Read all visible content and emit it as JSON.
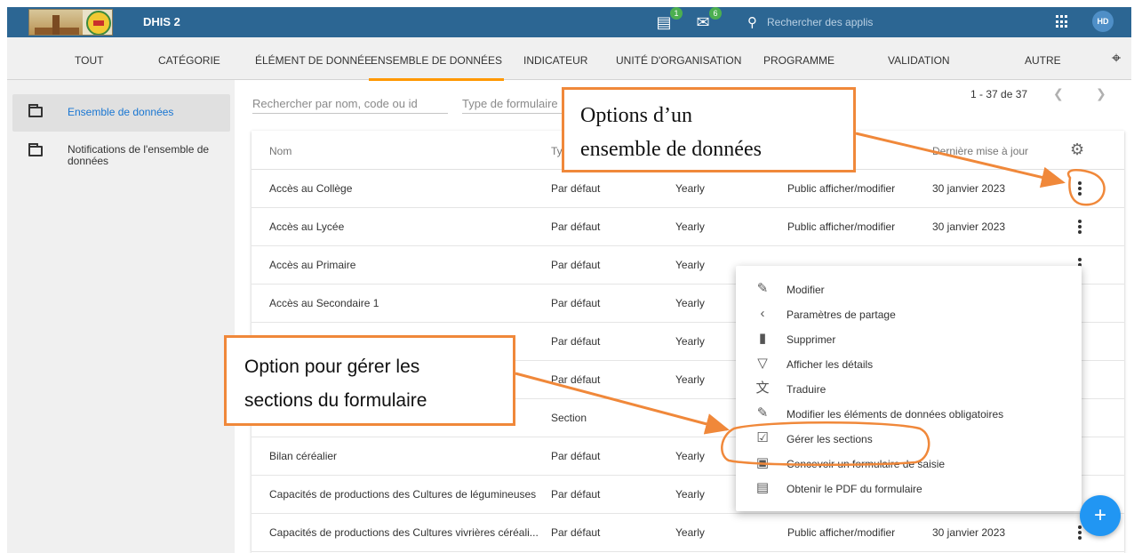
{
  "header": {
    "app_title": "DHIS 2",
    "messages_badge": "1",
    "interpretations_badge": "6",
    "search_placeholder": "Rechercher des applis",
    "avatar_initials": "HD"
  },
  "tabs": [
    {
      "label": "TOUT"
    },
    {
      "label": "CATÉGORIE"
    },
    {
      "label": "ÉLÉMENT DE DONNÉE"
    },
    {
      "label": "ENSEMBLE DE DONNÉES"
    },
    {
      "label": "INDICATEUR"
    },
    {
      "label": "UNITÉ D'ORGANISATION"
    },
    {
      "label": "PROGRAMME"
    },
    {
      "label": "VALIDATION"
    },
    {
      "label": "AUTRE"
    }
  ],
  "sidebar": {
    "items": [
      {
        "label": "Ensemble de données"
      },
      {
        "label": "Notifications de l'ensemble de données"
      }
    ]
  },
  "filters": {
    "search_placeholder": "Rechercher par nom, code ou id",
    "form_type_placeholder": "Type de formulaire"
  },
  "pager": {
    "range": "1 - 37 de 37"
  },
  "table": {
    "headers": {
      "name": "Nom",
      "type": "Ty",
      "last_updated": "Dernière mise à jour"
    },
    "rows": [
      {
        "name": "Accès au Collège",
        "type": "Par défaut",
        "period": "Yearly",
        "sharing": "Public afficher/modifier",
        "updated": "30 janvier 2023"
      },
      {
        "name": "Accès au Lycée",
        "type": "Par défaut",
        "period": "Yearly",
        "sharing": "Public afficher/modifier",
        "updated": "30 janvier 2023"
      },
      {
        "name": "Accès au Primaire",
        "type": "Par défaut",
        "period": "Yearly",
        "sharing": "",
        "updated": ""
      },
      {
        "name": "Accès au Secondaire 1",
        "type": "Par défaut",
        "period": "Yearly",
        "sharing": "",
        "updated": ""
      },
      {
        "name": "",
        "type": "Par défaut",
        "period": "Yearly",
        "sharing": "",
        "updated": ""
      },
      {
        "name": "",
        "type": "Par défaut",
        "period": "Yearly",
        "sharing": "",
        "updated": ""
      },
      {
        "name": "",
        "type": "Section",
        "period": "",
        "sharing": "",
        "updated": ""
      },
      {
        "name": "Bilan céréalier",
        "type": "Par défaut",
        "period": "Yearly",
        "sharing": "",
        "updated": ""
      },
      {
        "name": "Capacités de productions des Cultures de légumineuses",
        "type": "Par défaut",
        "period": "Yearly",
        "sharing": "",
        "updated": ""
      },
      {
        "name": "Capacités de productions des Cultures vivrières céréali...",
        "type": "Par défaut",
        "period": "Yearly",
        "sharing": "Public afficher/modifier",
        "updated": "30 janvier 2023"
      }
    ]
  },
  "context_menu": {
    "items": [
      {
        "label": "Modifier",
        "icon": "pencil-icon"
      },
      {
        "label": "Paramètres de partage",
        "icon": "share-icon"
      },
      {
        "label": "Supprimer",
        "icon": "trash-icon"
      },
      {
        "label": "Afficher les détails",
        "icon": "details-icon"
      },
      {
        "label": "Traduire",
        "icon": "translate-icon"
      },
      {
        "label": "Modifier les éléments de données obligatoires",
        "icon": "pencil-icon"
      },
      {
        "label": "Gérer les sections",
        "icon": "clipboard-check-icon"
      },
      {
        "label": "Concevoir un formulaire de saisie",
        "icon": "clipboard-account-icon"
      },
      {
        "label": "Obtenir le PDF du formulaire",
        "icon": "pdf-icon"
      }
    ]
  },
  "annotations": {
    "callout_options_line1": "Options d’un",
    "callout_options_line2": "ensemble de données",
    "callout_sections_line1": "Option pour gérer les",
    "callout_sections_line2": "sections du formulaire"
  },
  "colors": {
    "header": "#2c6693",
    "tab_indicator": "#ff9800",
    "active_link": "#1976d2",
    "fab": "#2196f3",
    "annotation": "#f0883a"
  }
}
